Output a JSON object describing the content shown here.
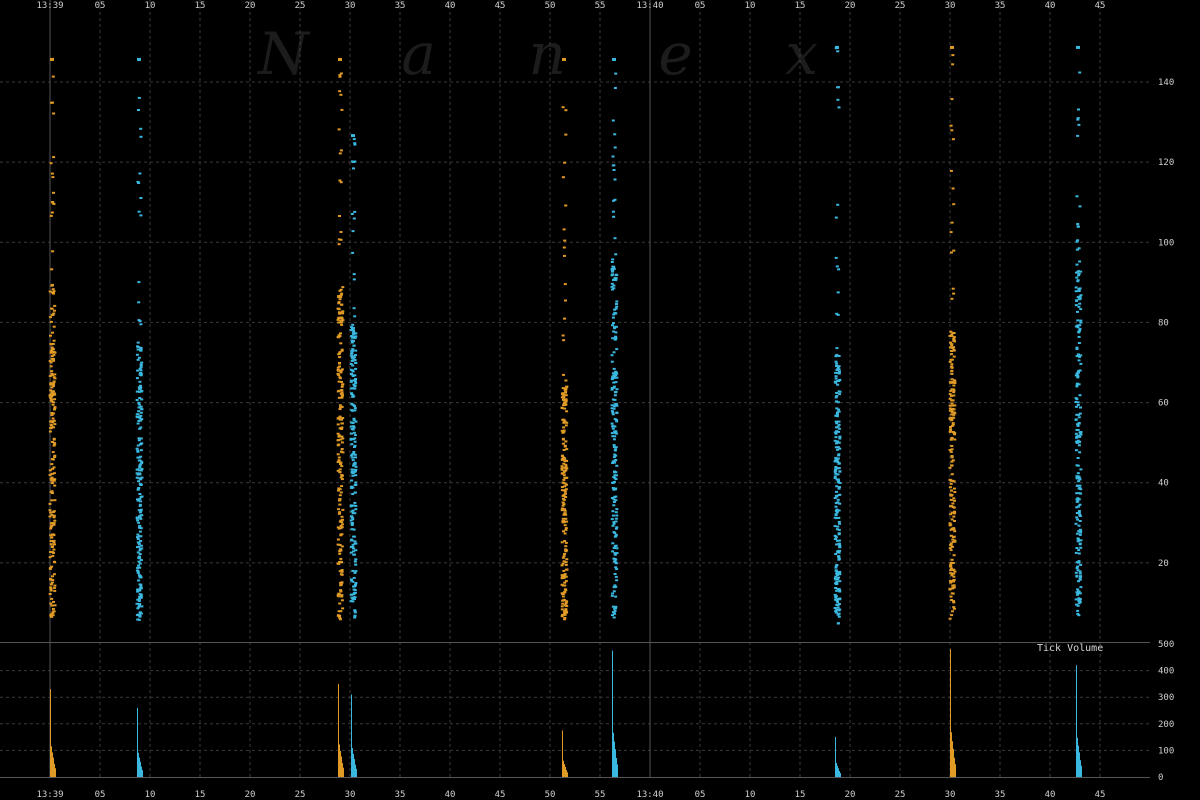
{
  "watermark": "N a n e x",
  "colors": {
    "background": "#000000",
    "grid": "#3a3a3a",
    "divider": "#555555",
    "buy_series": "#e09a26",
    "sell_series": "#3bb8e0",
    "text": "#cfcfcf"
  },
  "chart_data": [
    {
      "type": "scatter",
      "title": "",
      "xlabel": "",
      "ylabel": "",
      "x_tick_labels": [
        "13:39",
        "05",
        "10",
        "15",
        "20",
        "25",
        "30",
        "35",
        "40",
        "45",
        "50",
        "55",
        "13:40",
        "05",
        "10",
        "15",
        "20",
        "25",
        "30",
        "35",
        "40",
        "45"
      ],
      "x_range_seconds": [
        0,
        110
      ],
      "ylim": [
        5,
        150
      ],
      "y_ticks": [
        20,
        40,
        60,
        80,
        100,
        120,
        140
      ],
      "grid": true,
      "series": [
        {
          "color": "orange",
          "bursts": [
            {
              "t": 0.1,
              "min": 6,
              "max": 146,
              "dense_max": 90
            },
            {
              "t": 28.9,
              "min": 6,
              "max": 146,
              "dense_max": 90
            },
            {
              "t": 51.3,
              "min": 6,
              "max": 146,
              "dense_max": 66
            },
            {
              "t": 90.1,
              "min": 6,
              "max": 149,
              "dense_max": 78
            }
          ]
        },
        {
          "color": "blue",
          "bursts": [
            {
              "t": 8.8,
              "min": 6,
              "max": 146,
              "dense_max": 75
            },
            {
              "t": 30.2,
              "min": 6,
              "max": 127,
              "dense_max": 80
            },
            {
              "t": 56.3,
              "min": 6,
              "max": 146,
              "dense_max": 96
            },
            {
              "t": 78.6,
              "min": 5,
              "max": 149,
              "dense_max": 72
            },
            {
              "t": 102.7,
              "min": 6,
              "max": 149,
              "dense_max": 95
            }
          ]
        }
      ]
    },
    {
      "type": "bar",
      "title": "Tick Volume",
      "ylim": [
        0,
        500
      ],
      "y_ticks": [
        0,
        100,
        200,
        300,
        400,
        500
      ],
      "series": [
        {
          "color": "orange",
          "spikes": [
            {
              "t": 0.1,
              "peak": 330
            },
            {
              "t": 28.9,
              "peak": 350
            },
            {
              "t": 51.3,
              "peak": 175
            },
            {
              "t": 90.1,
              "peak": 480
            }
          ]
        },
        {
          "color": "blue",
          "spikes": [
            {
              "t": 8.8,
              "peak": 260
            },
            {
              "t": 30.2,
              "peak": 310
            },
            {
              "t": 56.3,
              "peak": 475
            },
            {
              "t": 78.6,
              "peak": 150
            },
            {
              "t": 102.7,
              "peak": 420
            }
          ]
        }
      ]
    }
  ]
}
